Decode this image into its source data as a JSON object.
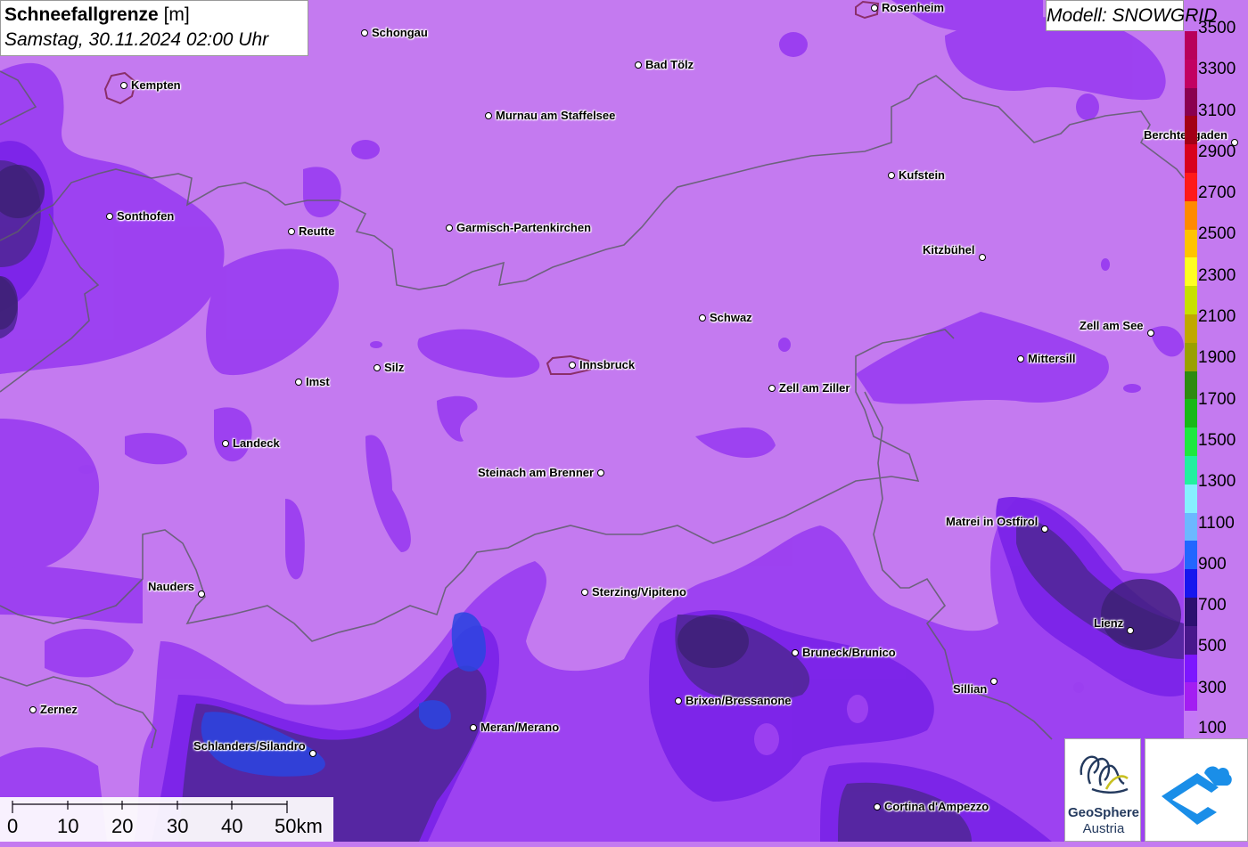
{
  "header": {
    "title_bold": "Schneefallgrenze",
    "title_unit": " [m]",
    "datetime": "Samstag, 30.11.2024 02:00 Uhr",
    "model": "Modell: SNOWGRID"
  },
  "legend": {
    "labels": [
      "3500",
      "3300",
      "3100",
      "2900",
      "2700",
      "2500",
      "2300",
      "2100",
      "1900",
      "1700",
      "1500",
      "1300",
      "1100",
      "900",
      "700",
      "500",
      "300",
      "100"
    ],
    "colors": [
      "#b8005a",
      "#c20062",
      "#8a0050",
      "#a30016",
      "#d8001e",
      "#ff1a1a",
      "#ff8a00",
      "#ffc400",
      "#ffff22",
      "#c8e000",
      "#c0a800",
      "#9aa000",
      "#2e8a10",
      "#18b818",
      "#1fe840",
      "#22f0a0",
      "#86f0ff",
      "#6cb8ff",
      "#2266ff",
      "#1616ee",
      "#2c1070",
      "#48188c",
      "#7d16ff",
      "#a31ef2",
      "#c478f6"
    ],
    "colors_note": ""
  },
  "cities": [
    {
      "name": "Schongau"
    },
    {
      "name": "Rosenheim"
    },
    {
      "name": "Bad Tölz"
    },
    {
      "name": "Kempten"
    },
    {
      "name": "Murnau am Staffelsee"
    },
    {
      "name": "Berchtesgaden"
    },
    {
      "name": "Kufstein"
    },
    {
      "name": "Sonthofen"
    },
    {
      "name": "Reutte"
    },
    {
      "name": "Garmisch-Partenkirchen"
    },
    {
      "name": "Kitzbühel"
    },
    {
      "name": "Schwaz"
    },
    {
      "name": "Zell am See"
    },
    {
      "name": "Imst"
    },
    {
      "name": "Silz"
    },
    {
      "name": "Innsbruck"
    },
    {
      "name": "Mittersill"
    },
    {
      "name": "Zell am Ziller"
    },
    {
      "name": "Landeck"
    },
    {
      "name": "Steinach am Brenner"
    },
    {
      "name": "Matrei in Ostfirol"
    },
    {
      "name": "Nauders"
    },
    {
      "name": "Sterzing/Vipiteno"
    },
    {
      "name": "Lienz"
    },
    {
      "name": "Bruneck/Brunico"
    },
    {
      "name": "Sillian"
    },
    {
      "name": "Zernez"
    },
    {
      "name": "Brixen/Bressanone"
    },
    {
      "name": "Meran/Merano"
    },
    {
      "name": "Schlanders/Silandro"
    },
    {
      "name": "Cortina d'Ampezzo"
    }
  ],
  "scale": {
    "labels": [
      "0",
      "10",
      "20",
      "30",
      "40",
      "50km"
    ]
  },
  "logos": {
    "geosphere_line1": "GeoSphere",
    "geosphere_line2": "Austria"
  },
  "colors": {
    "base_fill": "#c47af0",
    "low_fill": "#9a40f2",
    "lower_fill": "#7d16ff",
    "dark_fill": "#5a249e",
    "deep_fill": "#3a2ab8",
    "blue_fill": "#2c3ce8",
    "border": "#5e5e6a"
  }
}
